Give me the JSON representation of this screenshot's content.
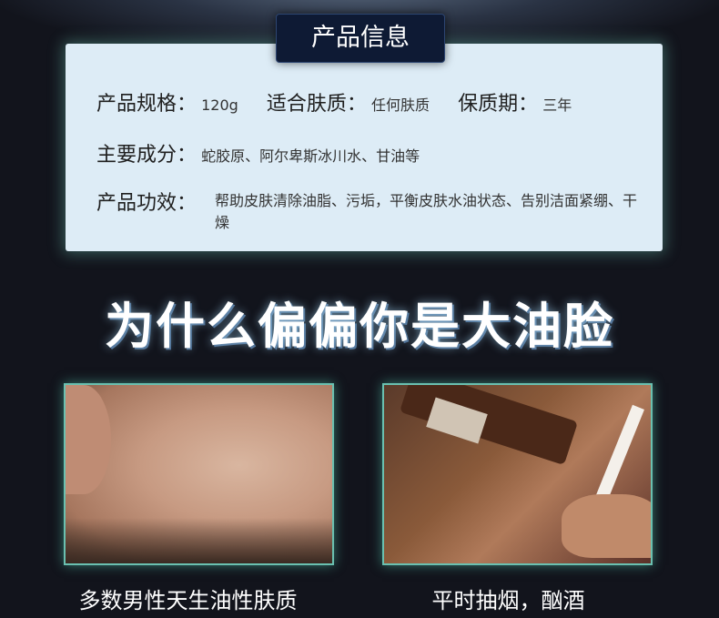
{
  "title_badge": "产品信息",
  "info": {
    "spec_label": "产品规格：",
    "spec_value": "120g",
    "skin_label": "适合肤质：",
    "skin_value": "任何肤质",
    "shelf_label": "保质期：",
    "shelf_value": "三年",
    "ingredients_label": "主要成分：",
    "ingredients_value": "蛇胶原、阿尔卑斯冰川水、甘油等",
    "effect_label": "产品功效：",
    "effect_value": "帮助皮肤清除油脂、污垢，平衡皮肤水油状态、告别洁面紧绷、干燥"
  },
  "headline": "为什么偏偏你是大油脸",
  "captions": {
    "left": "多数男性天生油性肤质",
    "right": "平时抽烟，酗酒"
  }
}
